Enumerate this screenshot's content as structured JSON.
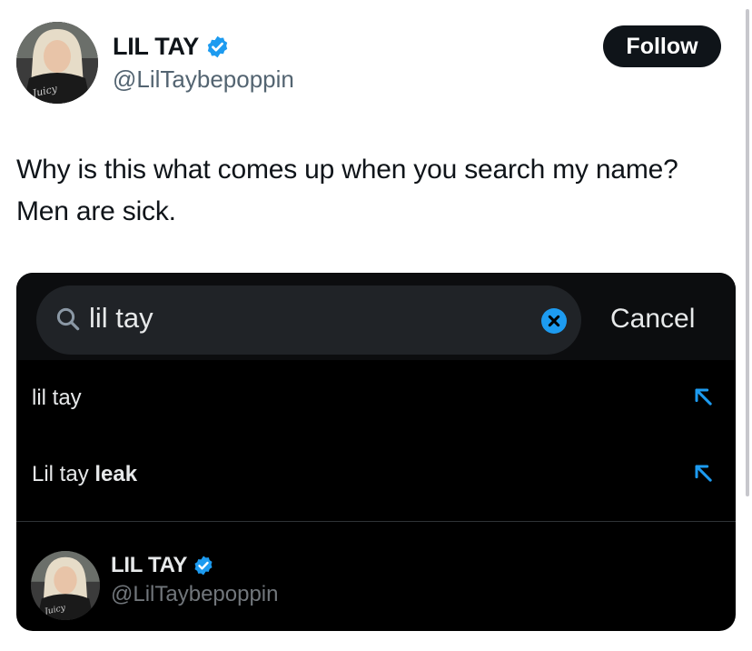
{
  "tweet": {
    "author_name": "LIL TAY",
    "author_handle": "@LilTaybepoppin",
    "follow_label": "Follow",
    "text": "Why is this what comes up when you search my name? Men are sick.",
    "avatar_shirt_text": "Juicy"
  },
  "embed": {
    "search": {
      "value": "lil tay",
      "cancel_label": "Cancel"
    },
    "suggestions": [
      {
        "prefix": "lil tay",
        "bold": ""
      },
      {
        "prefix": "Lil tay ",
        "bold": "leak"
      }
    ],
    "user_result": {
      "name": "LIL TAY",
      "handle": "@LilTaybepoppin",
      "avatar_shirt_text": "Juicy"
    }
  },
  "colors": {
    "verified_blue": "#1d9bf0",
    "follow_bg": "#0f1419",
    "embed_bg": "#000000",
    "search_box_bg": "#202327"
  },
  "icons": [
    "verified-badge-icon",
    "search-icon",
    "clear-icon",
    "arrow-up-left-icon"
  ]
}
